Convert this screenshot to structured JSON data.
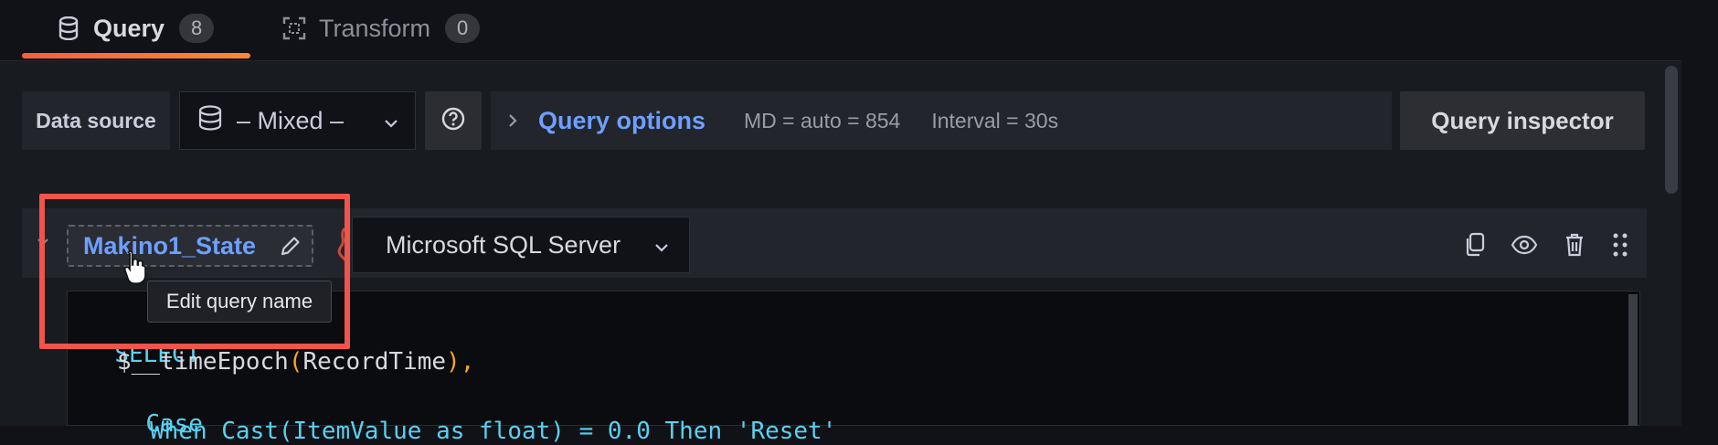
{
  "tabs": [
    {
      "label": "Query",
      "count": "8",
      "icon": "database-icon"
    },
    {
      "label": "Transform",
      "count": "0",
      "icon": "transform-icon"
    }
  ],
  "toolbar": {
    "data_source_label": "Data source",
    "data_source_value": "– Mixed –",
    "query_options_label": "Query options",
    "md_text": "MD = auto = 854",
    "interval_text": "Interval = 30s",
    "query_inspector_label": "Query inspector"
  },
  "query": {
    "name": "Makino1_State",
    "datasource": "Microsoft SQL Server",
    "tooltip": "Edit query name"
  },
  "code": {
    "line1_keyword": "SELECT",
    "line2_fn": "$__timeEpoch",
    "line2_open": "(",
    "line2_arg": "RecordTime",
    "line2_close": "),",
    "line3_keyword": "Case",
    "line4_partial": "When Cast(ItemValue as float) = 0.0 Then 'Reset'"
  },
  "colors": {
    "accent_tab": "#f55f3e",
    "link_blue": "#6e9fff",
    "highlight_red": "#f0544a"
  }
}
